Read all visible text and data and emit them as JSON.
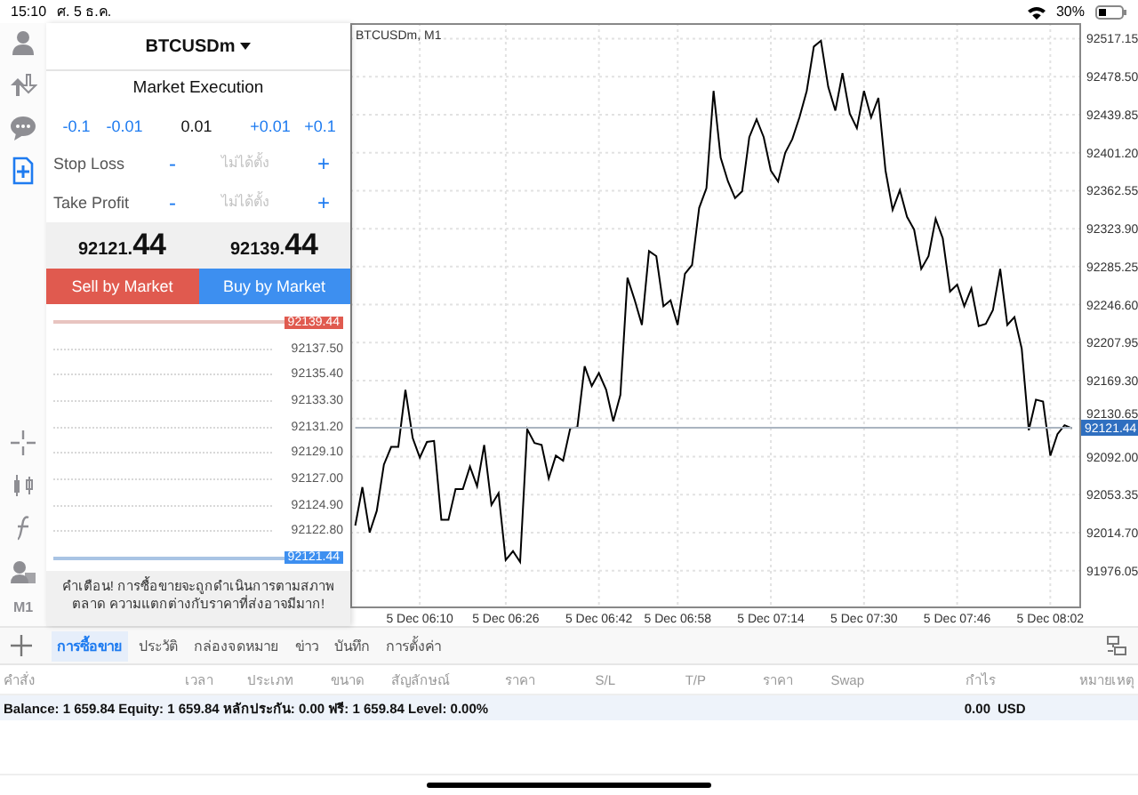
{
  "status_bar": {
    "time": "15:10",
    "date": "ศ. 5 ธ.ค.",
    "battery": "30%"
  },
  "toolbar": [
    {
      "kind": "account",
      "selected": false
    },
    {
      "kind": "trade",
      "selected": false
    },
    {
      "kind": "chat",
      "selected": false
    },
    {
      "kind": "new_order",
      "selected": true
    },
    {
      "kind": "crosshair",
      "selected": false
    },
    {
      "kind": "chart_type",
      "selected": false
    },
    {
      "kind": "indicators",
      "selected": false
    },
    {
      "kind": "objects",
      "selected": false
    },
    {
      "kind": "timeframe",
      "label": "M1",
      "selected": false
    }
  ],
  "order_panel": {
    "symbol": "BTCUSDm",
    "execution": "Market Execution",
    "volume": {
      "decrease": [
        "-0.1",
        "-0.01"
      ],
      "value": "0.01",
      "increase": [
        "+0.01",
        "+0.1"
      ]
    },
    "levels": [
      {
        "label": "Stop Loss",
        "minus": "-",
        "placeholder": "ไม่ได้ตั้ง",
        "plus": "+"
      },
      {
        "label": "Take Profit",
        "minus": "-",
        "placeholder": "ไม่ได้ตั้ง",
        "plus": "+"
      }
    ],
    "bid": {
      "main": "92121.",
      "pips": "44"
    },
    "ask": {
      "main": "92139.",
      "pips": "44"
    },
    "buttons": [
      {
        "kind": "sell",
        "label": "Sell by Market"
      },
      {
        "kind": "buy",
        "label": "Buy by Market"
      }
    ],
    "ladder": {
      "ask": "92139.44",
      "prices": [
        "92137.50",
        "92135.40",
        "92133.30",
        "92131.20",
        "92129.10",
        "92127.00",
        "92124.90",
        "92122.80"
      ],
      "bid": "92121.44"
    },
    "warning": "คำเตือน! การซื้อขายจะถูกดำเนินการตามสภาพตลาด ความแตกต่างกับราคาที่ส่งอาจมีมาก!"
  },
  "chart": {
    "title": "BTCUSDm, M1",
    "current_price": "92121.44",
    "chart_data": {
      "type": "line",
      "grid": true,
      "categories": [
        null,
        null,
        null,
        null,
        null,
        null,
        null,
        null,
        null,
        "5 Dec 06:10",
        null,
        null,
        null,
        null,
        null,
        null,
        null,
        null,
        null,
        null,
        null,
        "5 Dec 06:26",
        null,
        null,
        null,
        null,
        null,
        null,
        null,
        null,
        null,
        null,
        null,
        null,
        "5 Dec 06:42",
        null,
        null,
        null,
        null,
        null,
        null,
        null,
        null,
        null,
        null,
        "5 Dec 06:58",
        null,
        null,
        null,
        null,
        null,
        null,
        null,
        null,
        null,
        null,
        null,
        null,
        "5 Dec 07:14",
        null,
        null,
        null,
        null,
        null,
        null,
        null,
        null,
        null,
        null,
        null,
        null,
        "5 Dec 07:30",
        null,
        null,
        null,
        null,
        null,
        null,
        null,
        null,
        null,
        null,
        null,
        null,
        "5 Dec 07:46",
        null,
        null,
        null,
        null,
        null,
        null,
        null,
        null,
        null,
        null,
        null,
        null,
        "5 Dec 08:02",
        null,
        null,
        null
      ],
      "series": [
        {
          "color": "#000000",
          "values": [
            92022,
            92061,
            92015,
            92037,
            92084,
            92102,
            92102,
            92160,
            92111,
            92091,
            92107,
            92108,
            92028,
            92028,
            92059,
            92059,
            92082,
            92062,
            92104,
            92043,
            92055,
            91987,
            91996,
            91985,
            92120,
            92106,
            92104,
            92070,
            92093,
            92088,
            92121,
            92122,
            92184,
            92164,
            92177,
            92160,
            92128,
            92155,
            92274,
            92251,
            92226,
            92301,
            92296,
            92245,
            92251,
            92226,
            92278,
            92287,
            92345,
            92365,
            92464,
            92396,
            92372,
            92355,
            92362,
            92417,
            92435,
            92417,
            92383,
            92372,
            92401,
            92415,
            92437,
            92464,
            92509,
            92515,
            92468,
            92444,
            92482,
            92441,
            92426,
            92464,
            92437,
            92457,
            92383,
            92343,
            92363,
            92336,
            92323,
            92283,
            92296,
            92334,
            92314,
            92260,
            92267,
            92245,
            92263,
            92225,
            92227,
            92241,
            92283,
            92226,
            92234,
            92202,
            92119,
            92150,
            92148,
            92093,
            92115,
            92124,
            92121
          ]
        },
        {
          "color": "#aab4c0",
          "values": [
            92121.44,
            92121.44,
            92121.44,
            92121.44,
            92121.44,
            92121.44,
            92121.44,
            92121.44,
            92121.44,
            92121.44,
            92121.44,
            92121.44,
            92121.44,
            92121.44,
            92121.44,
            92121.44,
            92121.44,
            92121.44,
            92121.44,
            92121.44,
            92121.44,
            92121.44,
            92121.44,
            92121.44,
            92121.44,
            92121.44,
            92121.44,
            92121.44,
            92121.44,
            92121.44,
            92121.44,
            92121.44,
            92121.44,
            92121.44,
            92121.44,
            92121.44,
            92121.44,
            92121.44,
            92121.44,
            92121.44,
            92121.44,
            92121.44,
            92121.44,
            92121.44,
            92121.44,
            92121.44,
            92121.44,
            92121.44,
            92121.44,
            92121.44,
            92121.44,
            92121.44,
            92121.44,
            92121.44,
            92121.44,
            92121.44,
            92121.44,
            92121.44,
            92121.44,
            92121.44,
            92121.44,
            92121.44,
            92121.44,
            92121.44,
            92121.44,
            92121.44,
            92121.44,
            92121.44,
            92121.44,
            92121.44,
            92121.44,
            92121.44,
            92121.44,
            92121.44,
            92121.44,
            92121.44,
            92121.44,
            92121.44,
            92121.44,
            92121.44,
            92121.44,
            92121.44,
            92121.44,
            92121.44,
            92121.44,
            92121.44,
            92121.44,
            92121.44,
            92121.44,
            92121.44,
            92121.44,
            92121.44,
            92121.44,
            92121.44,
            92121.44,
            92121.44,
            92121.44,
            92121.44,
            92121.44,
            92121.44,
            92121.44
          ]
        }
      ],
      "ylim": [
        91937.9,
        92532.9
      ],
      "yticks": [
        {
          "value": 91976.05,
          "label": "91976.05"
        },
        {
          "value": 92014.7,
          "label": "92014.70"
        },
        {
          "value": 92053.35,
          "label": "92053.35"
        },
        {
          "value": 92092,
          "label": "92092.00"
        },
        {
          "value": 92130.65,
          "label": "92130.65"
        },
        {
          "value": 92169.3,
          "label": "92169.30"
        },
        {
          "value": 92207.95,
          "label": "92207.95"
        },
        {
          "value": 92246.6,
          "label": "92246.60"
        },
        {
          "value": 92285.25,
          "label": "92285.25"
        },
        {
          "value": 92323.9,
          "label": "92323.90"
        },
        {
          "value": 92362.55,
          "label": "92362.55"
        },
        {
          "value": 92401.2,
          "label": "92401.20"
        },
        {
          "value": 92439.85,
          "label": "92439.85"
        },
        {
          "value": 92478.5,
          "label": "92478.50"
        },
        {
          "value": 92517.15,
          "label": "92517.15"
        }
      ]
    }
  },
  "terminal": {
    "tabs": [
      {
        "label": "การซื้อขาย",
        "selected": true
      },
      {
        "label": "ประวัติ",
        "selected": false
      },
      {
        "label": "กล่องจดหมาย",
        "selected": false
      },
      {
        "label": "ข่าว",
        "selected": false
      },
      {
        "label": "บันทึก",
        "selected": false
      },
      {
        "label": "การตั้งค่า",
        "selected": false
      }
    ],
    "columns": [
      "คำสั่ง",
      "เวลา",
      "ประเภท",
      "ขนาด",
      "สัญลักษณ์",
      "ราคา",
      "S/L",
      "T/P",
      "ราคา",
      "Swap",
      "กำไร",
      "หมายเหตุ"
    ],
    "summary": {
      "text": "Balance: 1 659.84 Equity: 1 659.84 หลักประกัน: 0.00 ฟรี: 1 659.84 Level: 0.00%",
      "profit": "0.00",
      "currency": "USD"
    }
  }
}
